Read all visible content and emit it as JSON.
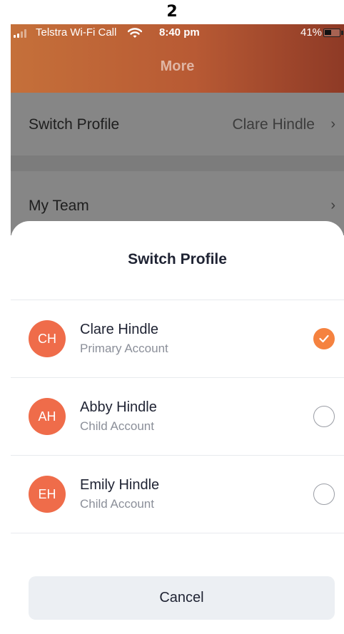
{
  "page_number": "2",
  "status_bar": {
    "carrier": "Telstra Wi-Fi Call",
    "time": "8:40 pm",
    "battery": "41%"
  },
  "header": {
    "title": "More"
  },
  "background_list": {
    "items": [
      {
        "label": "Switch Profile",
        "value": "Clare Hindle",
        "chevron": "›"
      },
      {
        "label": "My Team",
        "chevron": "›"
      }
    ]
  },
  "sheet": {
    "title": "Switch Profile",
    "profiles": [
      {
        "initials": "CH",
        "name": "Clare Hindle",
        "type": "Primary Account",
        "selected": true
      },
      {
        "initials": "AH",
        "name": "Abby Hindle",
        "type": "Child Account",
        "selected": false
      },
      {
        "initials": "EH",
        "name": "Emily Hindle",
        "type": "Child Account",
        "selected": false
      }
    ],
    "cancel_label": "Cancel"
  },
  "colors": {
    "accent": "#f5823f",
    "avatar": "#ef6c4a",
    "header_gradient_start": "#c5703a",
    "header_gradient_end": "#8e3a26"
  },
  "icons": [
    "wifi-icon",
    "signal-icon",
    "battery-icon",
    "chevron-right-icon",
    "checkmark-icon"
  ]
}
